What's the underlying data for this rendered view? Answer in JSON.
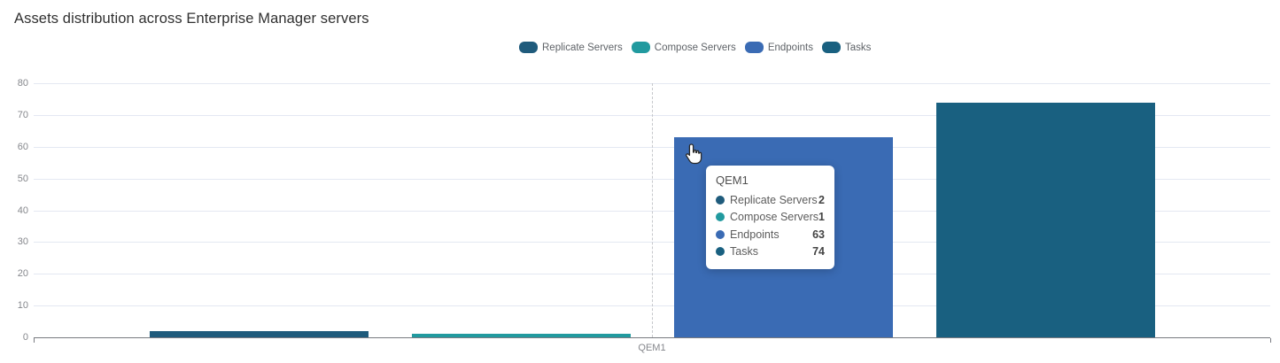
{
  "title": "Assets distribution across Enterprise Manager servers",
  "chart_data": {
    "type": "bar",
    "categories": [
      "QEM1"
    ],
    "series": [
      {
        "name": "Replicate Servers",
        "values": [
          2
        ],
        "color": "#1f5b7c"
      },
      {
        "name": "Compose Servers",
        "values": [
          1
        ],
        "color": "#219a9f"
      },
      {
        "name": "Endpoints",
        "values": [
          63
        ],
        "color": "#3a6bb4"
      },
      {
        "name": "Tasks",
        "values": [
          74
        ],
        "color": "#196080"
      }
    ],
    "title": "Assets distribution across Enterprise Manager servers",
    "xlabel": "",
    "ylabel": "",
    "ylim": [
      0,
      80
    ],
    "yticks": [
      0,
      10,
      20,
      30,
      40,
      50,
      60,
      70,
      80
    ],
    "grid": true,
    "legend_position": "top-center",
    "hovered_category": "QEM1"
  },
  "legend": {
    "items": [
      {
        "label": "Replicate Servers",
        "color": "#1f5b7c"
      },
      {
        "label": "Compose Servers",
        "color": "#219a9f"
      },
      {
        "label": "Endpoints",
        "color": "#3a6bb4"
      },
      {
        "label": "Tasks",
        "color": "#196080"
      }
    ]
  },
  "tooltip": {
    "title": "QEM1",
    "rows": [
      {
        "label": "Replicate Servers",
        "value": "2",
        "color": "#1f5b7c"
      },
      {
        "label": "Compose Servers",
        "value": "1",
        "color": "#219a9f"
      },
      {
        "label": "Endpoints",
        "value": "63",
        "color": "#3a6bb4"
      },
      {
        "label": "Tasks",
        "value": "74",
        "color": "#196080"
      }
    ]
  },
  "x_axis": {
    "category_label": "QEM1"
  },
  "icons": {
    "cursor": "hand-pointer-icon"
  }
}
